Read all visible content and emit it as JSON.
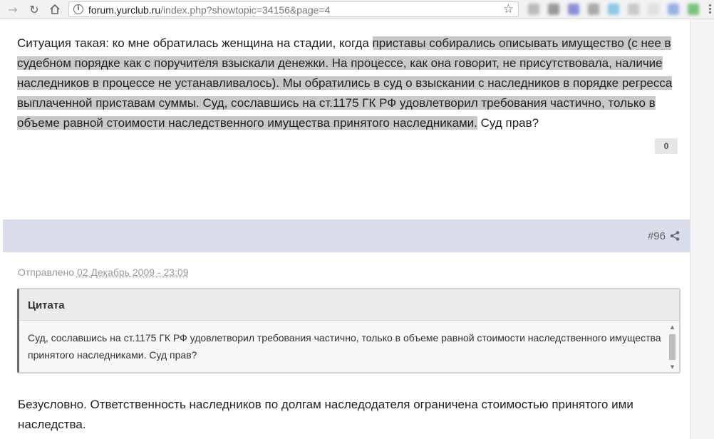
{
  "browser": {
    "url_host": "forum.yurclub.ru",
    "url_path": "/index.php?showtopic=34156&page=4"
  },
  "post": {
    "text_before": "Ситуация такая: ко мне обратилась женщина на стадии, когда ",
    "text_highlighted": "приставы собирались описывать имущество (с нее в судебном порядке как с поручителя взыскали денежки. На процессе, как она говорит, не присутствовала, наличие наследников в процессе не устанавливалось). Мы обратились в суд о взыскании с наследников в порядке регресса выплаченной приставам суммы. Суд, сославшись на ст.1175 ГК РФ удовлетворил требования частично, только в объеме равной стоимости наследственного имущества принятого наследниками.",
    "text_after": " Суд прав?",
    "vote_count": "0"
  },
  "next_post": {
    "number": "#96",
    "sent_label": "Отправлено ",
    "sent_date": "02 Декабрь 2009 - 23:09",
    "quote_title": "Цитата",
    "quote_text": "Суд, сославшись на ст.1175 ГК РФ удовлетворил требования частично, только в объеме равной стоимости наследственного имущества принятого наследниками. Суд прав?",
    "answer": "Безусловно. Ответственность наследников по долгам наследодателя ограничена стоимостью принятого ими наследства."
  },
  "colors": {
    "highlight": "#c9c9c9",
    "post_header_bg": "#d9dceb",
    "quote_border": "#6b6b6b"
  },
  "icons": [
    "forward-icon",
    "reload-icon",
    "home-icon",
    "info-icon",
    "star-icon",
    "share-icon",
    "menu-icon"
  ]
}
